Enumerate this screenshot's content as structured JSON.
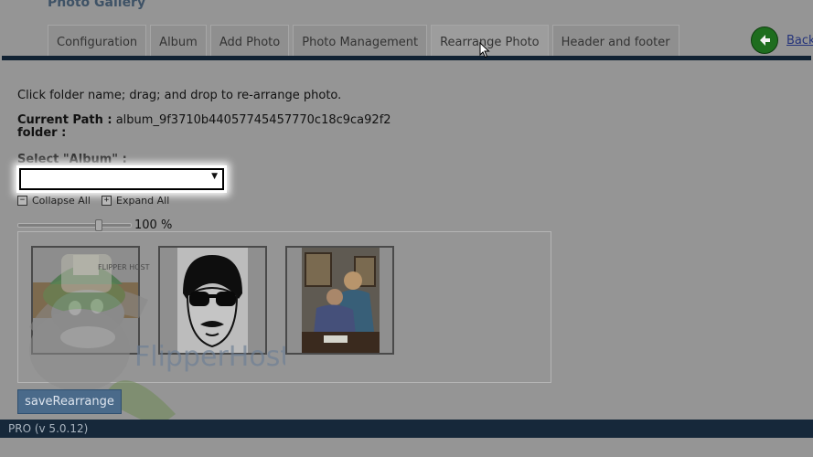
{
  "header": {
    "title": "Photo Gallery"
  },
  "tabs": [
    {
      "label": "Configuration",
      "active": false
    },
    {
      "label": "Album",
      "active": false
    },
    {
      "label": "Add Photo",
      "active": false
    },
    {
      "label": "Photo Management",
      "active": false
    },
    {
      "label": "Rearrange Photo",
      "active": true
    },
    {
      "label": "Header and footer",
      "active": false
    }
  ],
  "back": {
    "label": "Back"
  },
  "main": {
    "instructions": "Click folder name; drag; and drop to re-arrange photo.",
    "current_path_label": "Current Path :",
    "current_path_value": "album_9f3710b44057745457770c18c9ca92f2",
    "folder_label": "folder :",
    "select_album_label": "Select \"Album\" :",
    "select_album_value": "",
    "collapse_all": "Collapse All",
    "expand_all": "Expand All",
    "zoom": {
      "value_text": "100 %",
      "level": 0.73
    },
    "save_button": "saveRearrange"
  },
  "photos": [
    {
      "icon": "flipper-hat-photo"
    },
    {
      "icon": "sunglasses-face-photo"
    },
    {
      "icon": "couple-portrait-photo"
    }
  ],
  "watermark": {
    "brand": "FlipperHost",
    "hat_text": "FLIPPER HOST"
  },
  "footer": {
    "version": "PRO (v 5.0.12)"
  },
  "colors": {
    "overlay": "#959595",
    "tab_bar": "#112233",
    "footer": "#16283a",
    "save_button": "#4a6a8a",
    "back_icon": "#1e6d1e",
    "link": "#24337a"
  }
}
